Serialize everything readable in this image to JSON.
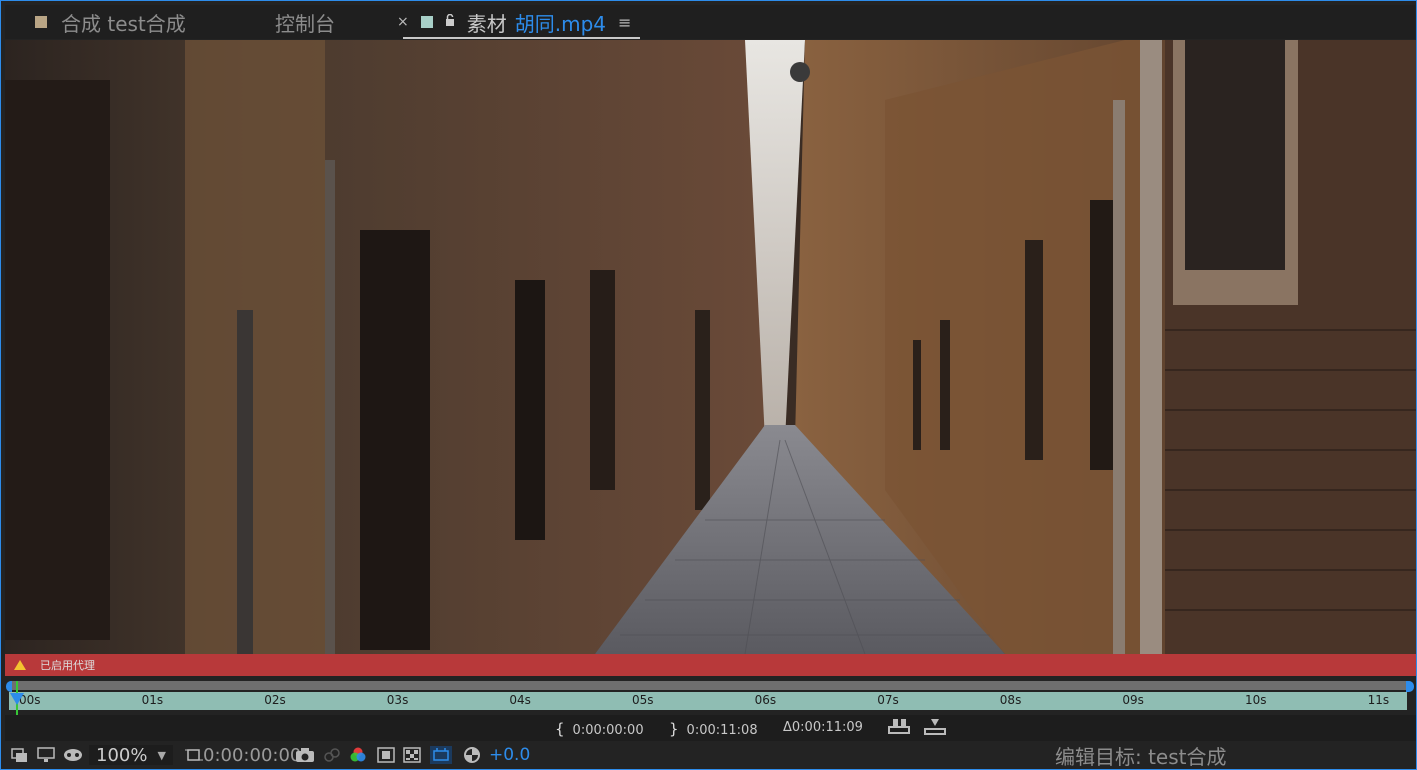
{
  "tabs": [
    {
      "label": "合成 test合成",
      "swatch_color": "#b9a585"
    },
    {
      "label": "控制台"
    },
    {
      "label_prefix": "素材 ",
      "label_file": "胡同.mp4",
      "swatch_color": "#a8d0c8",
      "active": true
    }
  ],
  "tab_icons": {
    "close": "×",
    "menu": "≡"
  },
  "viewer": {
    "image": "narrow cobblestone alley between old buildings"
  },
  "proxy": {
    "message": "已启用代理"
  },
  "ruler": {
    "ticks": [
      "00s",
      "01s",
      "02s",
      "03s",
      "04s",
      "05s",
      "06s",
      "07s",
      "08s",
      "09s",
      "10s",
      "11s"
    ],
    "current_time_fraction": 0.0
  },
  "inout": {
    "in_point": "0:00:00:00",
    "out_point": "0:00:11:08",
    "duration": "Δ0:00:11:09"
  },
  "toolbar": {
    "zoom": "100%",
    "timecode": "0:00:00:00",
    "exposure": "+0.0",
    "edit_target": "编辑目标: test合成"
  },
  "colors": {
    "accent": "#2d8ceb",
    "proxy_bar": "#b8393a",
    "ruler": "#8fbdb3",
    "playhead": "#37c837"
  }
}
